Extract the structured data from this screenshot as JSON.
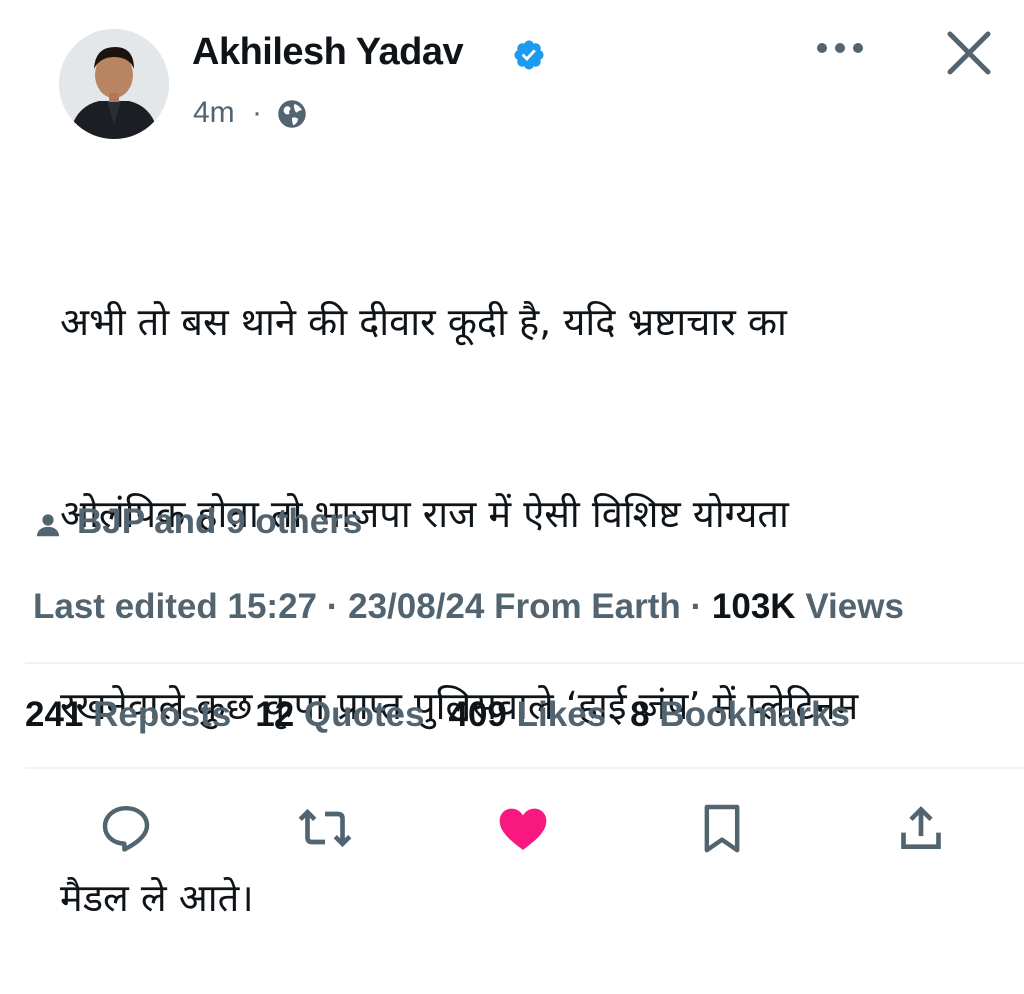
{
  "author": {
    "name": "Akhilesh Yadav",
    "time": "4m",
    "separator": "·"
  },
  "icons": {
    "verified": "verified-badge-icon",
    "globe": "globe-icon",
    "more": "more-icon",
    "close": "close-icon",
    "audience": "person-icon",
    "reply": "reply-icon",
    "repost": "repost-icon",
    "like": "heart-icon",
    "bookmark": "bookmark-icon",
    "share": "share-icon"
  },
  "colors": {
    "verified": "#1d9bf0",
    "like": "#f91880",
    "secondary_text": "#536471",
    "primary_text": "#0f1419"
  },
  "post": {
    "lines": [
      "अभी तो बस थाने की दीवार कूदी है, यदि भ्रष्टाचार का",
      "ओलंपिक होता तो भाजपा राज में ऐसी विशिष्ट योग्यता",
      "रखनेवाले कुछ कृपा प्राप्त पुलिसवाले ‘हाई जंप’ में प्लेटिनम",
      "मैडल ले आते।"
    ]
  },
  "audience": {
    "text": "BJP and 9 others"
  },
  "edit_info": {
    "prefix": "Last edited 15:27 · 23/08/24",
    "source": "From Earth",
    "separator": "·",
    "views_count": "103K",
    "views_label": "Views"
  },
  "stats": {
    "reposts_count": "241",
    "reposts_label": "Reposts",
    "quotes_count": "12",
    "quotes_label": "Quotes",
    "likes_count": "409",
    "likes_label": "Likes",
    "bookmarks_count": "8",
    "bookmarks_label": "Bookmarks"
  }
}
